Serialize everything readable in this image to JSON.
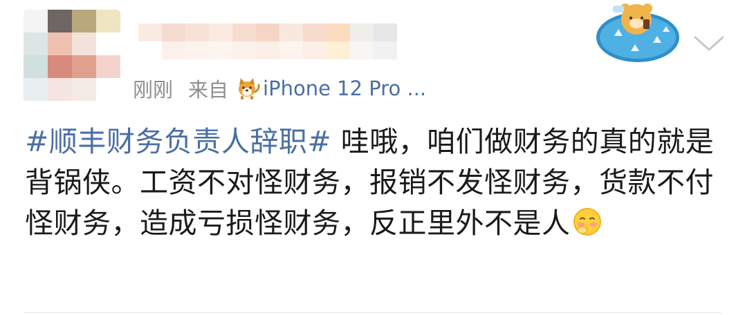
{
  "post": {
    "meta": {
      "time": "刚刚",
      "source_prefix": "来自",
      "device": "iPhone 12 Pro ...",
      "source_icon": "shiba-dog-icon"
    },
    "content": {
      "topic": "#顺丰财务负责人辞职#",
      "text": " 哇哦，咱们做财务的真的就是背锅侠。工资不对怪财务，报销不发怪财务，货款不付怪财务，造成亏损怪财务，反正里外不是人",
      "trailing_emoji": "shy-face-emoji-icon"
    },
    "header_actions": {
      "badge_icon": "cartoon-bear-badge-icon",
      "menu_icon": "chevron-down-icon"
    },
    "colors": {
      "topic": "#4a6fa5",
      "meta_text": "#8f8f8f",
      "body_text": "#1a1a1a",
      "background": "#ffffff"
    }
  }
}
